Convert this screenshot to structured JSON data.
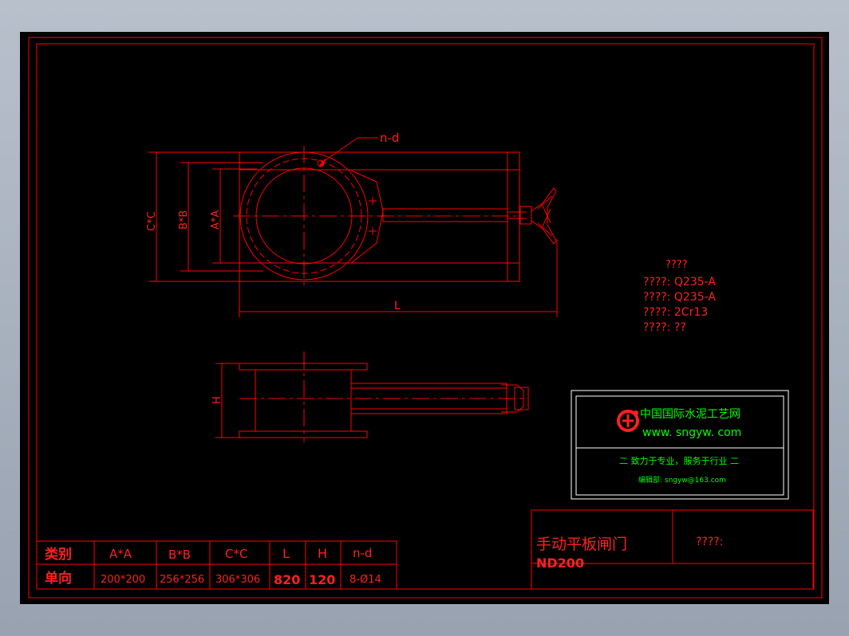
{
  "labels": {
    "nd": "n-d",
    "L": "L",
    "H": "H",
    "AA_dim": "A*A",
    "BB_dim": "B*B",
    "CC_dim": "C*C"
  },
  "materials": {
    "title": "????",
    "lines": [
      "????: Q235-A",
      "????: Q235-A",
      "????: 2Cr13",
      "????: ??"
    ]
  },
  "logo": {
    "cn": "中国国际水泥工艺网",
    "url": "www. sngyw. com",
    "slogan": "二  致力于专业，服务于行业  二",
    "email": "编辑部: sngyw@163.com"
  },
  "title_block": {
    "name_cn": "手动平板闸门",
    "model": "ND200",
    "note": "????:"
  },
  "spec_table": {
    "headers": [
      "类别",
      "A*A",
      "B*B",
      "C*C",
      "L",
      "H",
      "n-d"
    ],
    "row": [
      "单向",
      "200*200",
      "256*256",
      "306*306",
      "820",
      "120",
      "8-Ø14"
    ]
  },
  "colors": {
    "line": "#ff0000",
    "text_red": "#ff2020",
    "logo_green": "#00ff00",
    "background": "#000000"
  }
}
